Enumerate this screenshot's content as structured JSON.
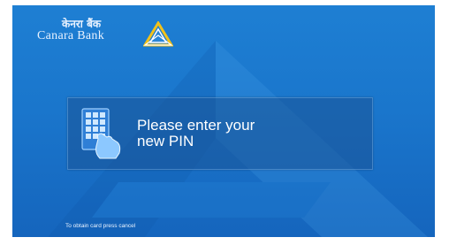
{
  "brand": {
    "name_hindi": "केनरा बैंक",
    "name_english": "Canara Bank",
    "logo_icon": "canara-bank-triangle-logo",
    "colors": {
      "background": "#1a76cc",
      "logo_yellow": "#f2c21b",
      "panel": "#1c5496",
      "text": "#ffffff"
    }
  },
  "prompt": {
    "icon": "pin-keypad-icon",
    "message": "Please enter your\nnew PIN"
  },
  "footer": {
    "hint": "To obtain card press cancel"
  }
}
